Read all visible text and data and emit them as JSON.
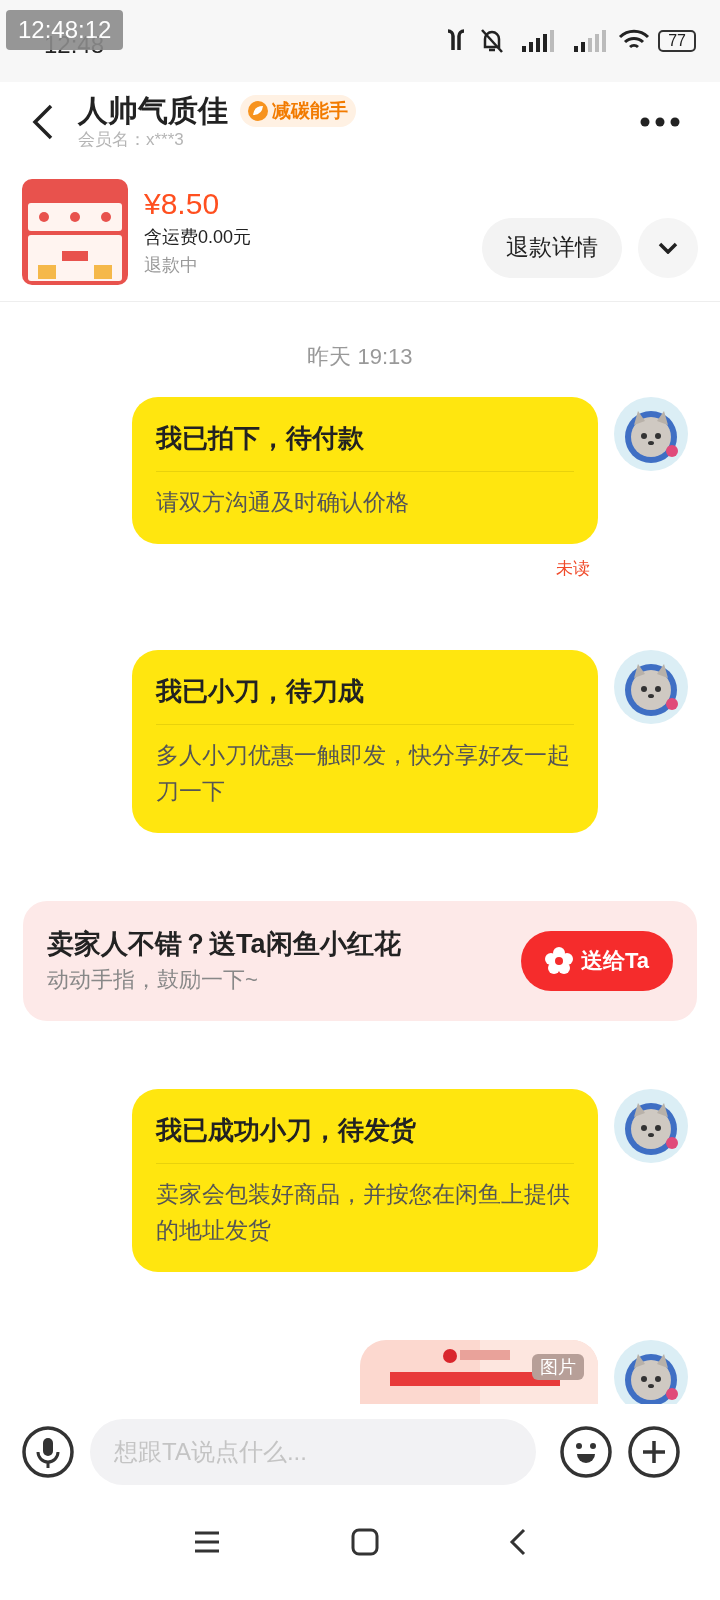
{
  "status_bar": {
    "time": "12:48",
    "overlay_time": "12:48:12",
    "battery": "77"
  },
  "header": {
    "title": "人帅气质佳",
    "badge": "减碳能手",
    "member": "会员名：x***3"
  },
  "product": {
    "price": "¥8.50",
    "shipping": "含运费0.00元",
    "status": "退款中",
    "button": "退款详情"
  },
  "timestamp": "昨天 19:13",
  "messages": [
    {
      "kind": "card",
      "title": "我已拍下，待付款",
      "body": "请双方沟通及时确认价格",
      "unread": "未读"
    },
    {
      "kind": "card",
      "title": "我已小刀，待刀成",
      "body": "多人小刀优惠一触即发，快分享好友一起刀一下"
    },
    {
      "kind": "promo",
      "title": "卖家人不错？送Ta闲鱼小红花",
      "body": "动动手指，鼓励一下~",
      "button": "送给Ta"
    },
    {
      "kind": "card",
      "title": "我已成功小刀，待发货",
      "body": "卖家会包装好商品，并按您在闲鱼上提供的地址发货"
    },
    {
      "badge": "图片"
    }
  ],
  "input": {
    "placeholder": "想跟TA说点什么..."
  }
}
